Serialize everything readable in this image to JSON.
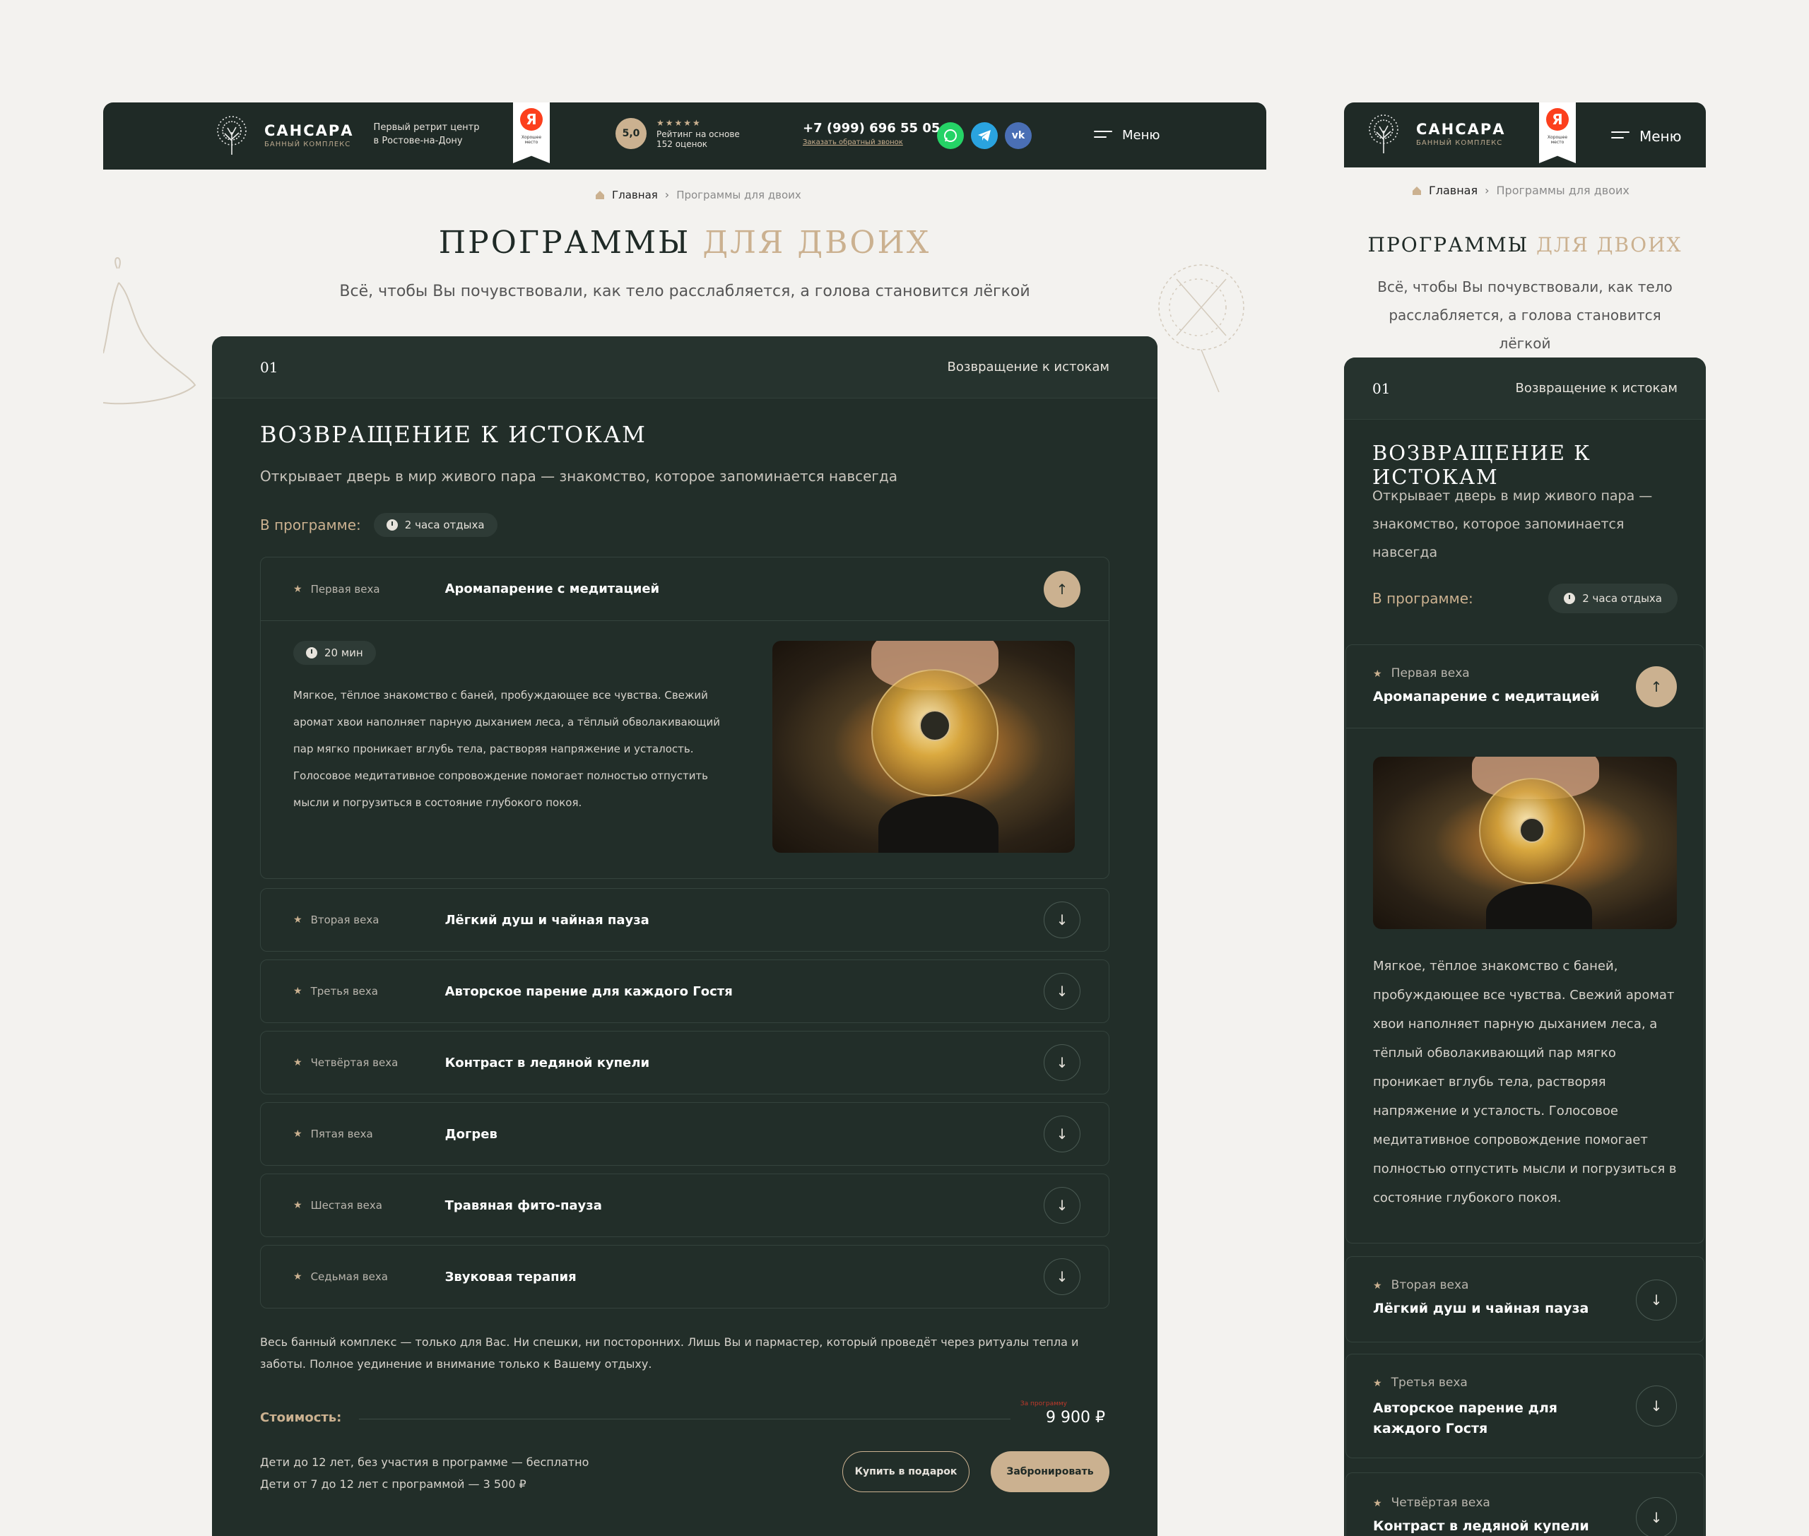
{
  "brand": {
    "name": "САНСАРА",
    "sub": "БАННЫЙ КОМПЛЕКС",
    "tagline_line1": "Первый ретрит центр",
    "tagline_line2": "в Ростове-на-Дону"
  },
  "yandex_badge": {
    "letter": "Я",
    "text": "Хорошее место"
  },
  "rating": {
    "score": "5,0",
    "stars": "★★★★★",
    "text_line1": "Рейтинг на основе",
    "text_line2": "152 оценок"
  },
  "contact": {
    "phone": "+7 (999) 696 55 05",
    "callback": "Заказать обратный звонок"
  },
  "social": [
    {
      "name": "whatsapp",
      "color": "#25d366"
    },
    {
      "name": "telegram",
      "color": "#2aa3df"
    },
    {
      "name": "vk",
      "color": "#4a6fb5"
    }
  ],
  "menu_label": "Меню",
  "breadcrumbs": {
    "home": "Главная",
    "separator": "›",
    "current": "Программы для двоих"
  },
  "page": {
    "title_main": "ПРОГРАММЫ",
    "title_accent": "ДЛЯ ДВОИХ",
    "subtitle": "Всё, чтобы Вы почувствовали, как тело расслабляется, а голова становится лёгкой"
  },
  "program": {
    "number": "01",
    "name": "Возвращение к истокам",
    "title": "ВОЗВРАЩЕНИЕ К ИСТОКАМ",
    "description": "Открывает дверь в мир живого пара — знакомство, которое запоминается навсегда",
    "in_program_label": "В программе:",
    "duration_pill": "2 часа отдыха",
    "stages": [
      {
        "label": "Первая веха",
        "title": "Аромапарение с медитацией",
        "open": true
      },
      {
        "label": "Вторая веха",
        "title": "Лёгкий душ и чайная пауза",
        "open": false
      },
      {
        "label": "Третья веха",
        "title": "Авторское парение для каждого Гостя",
        "open": false
      },
      {
        "label": "Четвёртая веха",
        "title": "Контраст в ледяной купели",
        "open": false
      },
      {
        "label": "Пятая веха",
        "title": "Догрев",
        "open": false
      },
      {
        "label": "Шестая веха",
        "title": "Травяная фито-пауза",
        "open": false
      },
      {
        "label": "Седьмая веха",
        "title": "Звуковая терапия",
        "open": false
      }
    ],
    "open_stage": {
      "duration": "20 мин",
      "text": "Мягкое, тёплое знакомство с баней, пробуждающее все чувства. Свежий аромат хвои наполняет парную дыханием леса, а тёплый обволакивающий пар мягко проникает вглубь тела, растворяя напряжение и усталость. Голосовое медитативное сопровождение помогает полностью отпустить мысли и погрузиться в состояние глубокого покоя."
    },
    "footer_text": "Весь банный комплекс — только для Вас. Ни спешки, ни посторонних. Лишь Вы и пармастер, который проведёт через ритуалы тепла и заботы. Полное уединение и внимание только к Вашему отдыху.",
    "price_label": "Стоимость:",
    "price_note": "За программу",
    "price": "9 900 ₽",
    "kids_line1": "Дети до 12 лет, без участия в программе — бесплатно",
    "kids_line2": "Дети от 7 до 12 лет с программой — 3 500 ₽",
    "btn_gift": "Купить в подарок",
    "btn_book": "Забронировать"
  },
  "icons": {
    "arrow_up": "↑",
    "arrow_down": "↓",
    "star": "★"
  },
  "colors": {
    "dark": "#1f2a26",
    "panel": "#222e29",
    "accent": "#cbb190",
    "background": "#f3f2ef"
  }
}
